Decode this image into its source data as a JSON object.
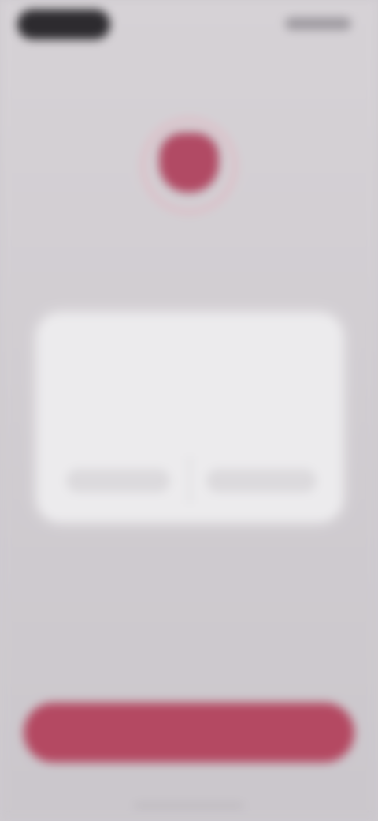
{
  "status_bar": {
    "pill_icon": "dynamic-island-pill",
    "indicators_icon": "signal-wifi-battery-icons"
  },
  "header": {
    "title": ""
  },
  "emblem": {
    "icon": "shield-icon",
    "color": "#b14a64",
    "ring_color": "#e3b1bd"
  },
  "section": {
    "heading": "",
    "subtitle": ""
  },
  "dialog": {
    "title": "",
    "body": "",
    "left_button_label": "",
    "right_button_label": ""
  },
  "primary_action": {
    "label": "",
    "color": "#b44962"
  },
  "colors": {
    "background": "#cfcbd0",
    "card": "#ecebed"
  }
}
